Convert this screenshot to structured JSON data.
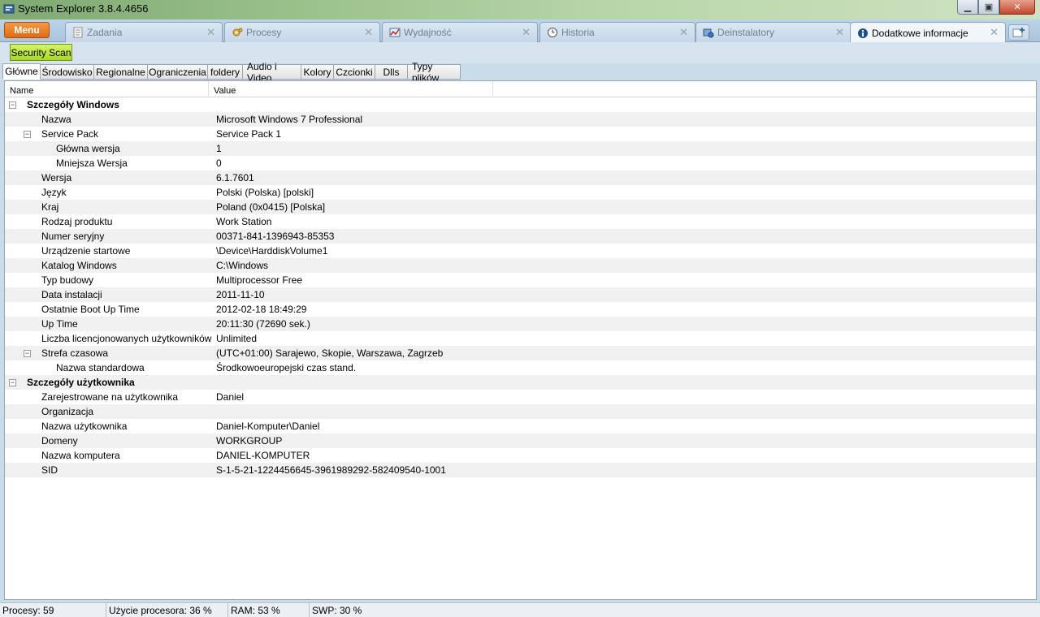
{
  "window": {
    "title": "System Explorer 3.8.4.4656",
    "min_label": "▁",
    "max_label": "▣",
    "close_label": "✕"
  },
  "menu": {
    "label": "Menu"
  },
  "tabs": [
    {
      "label": "Zadania",
      "icon": "tasks-icon"
    },
    {
      "label": "Procesy",
      "icon": "gears-icon"
    },
    {
      "label": "Wydajność",
      "icon": "performance-icon"
    },
    {
      "label": "Historia",
      "icon": "clock-icon"
    },
    {
      "label": "Deinstalatory",
      "icon": "uninstall-icon"
    },
    {
      "label": "Dodatkowe informacje",
      "icon": "info-icon"
    }
  ],
  "tab_close_label": "✕",
  "toolbar": {
    "security_scan": "Security Scan"
  },
  "subtabs": [
    "Główne",
    "Środowisko",
    "Regionalne",
    "Ograniczenia",
    "foldery",
    "Audio i Video",
    "Kolory",
    "Czcionki",
    "Dlls",
    "Typy plików"
  ],
  "grid": {
    "columns": {
      "name": "Name",
      "value": "Value"
    },
    "rows": [
      {
        "name": "Szczegóły Windows",
        "value": "",
        "level": 0,
        "group": true,
        "expander": "⊟"
      },
      {
        "name": "Nazwa",
        "value": "Microsoft Windows 7 Professional",
        "level": 1
      },
      {
        "name": "Service Pack",
        "value": "Service Pack 1",
        "level": 1,
        "expander": "⊟"
      },
      {
        "name": "Główna wersja",
        "value": "1",
        "level": 2
      },
      {
        "name": "Mniejsza Wersja",
        "value": "0",
        "level": 2
      },
      {
        "name": "Wersja",
        "value": "6.1.7601",
        "level": 1
      },
      {
        "name": "Język",
        "value": "Polski (Polska) [polski]",
        "level": 1
      },
      {
        "name": "Kraj",
        "value": "Poland (0x0415) [Polska]",
        "level": 1
      },
      {
        "name": "Rodzaj produktu",
        "value": "Work Station",
        "level": 1
      },
      {
        "name": "Numer seryjny",
        "value": "00371-841-1396943-85353",
        "level": 1
      },
      {
        "name": "Urządzenie startowe",
        "value": "\\Device\\HarddiskVolume1",
        "level": 1
      },
      {
        "name": "Katalog Windows",
        "value": "C:\\Windows",
        "level": 1
      },
      {
        "name": "Typ budowy",
        "value": "Multiprocessor Free",
        "level": 1
      },
      {
        "name": "Data instalacji",
        "value": "2011-11-10",
        "level": 1
      },
      {
        "name": "Ostatnie Boot Up Time",
        "value": "2012-02-18 18:49:29",
        "level": 1
      },
      {
        "name": "Up Time",
        "value": "20:11:30 (72690 sek.)",
        "level": 1
      },
      {
        "name": "Liczba licencjonowanych użytkowników",
        "value": "Unlimited",
        "level": 1
      },
      {
        "name": "Strefa czasowa",
        "value": "(UTC+01:00) Sarajewo, Skopie, Warszawa, Zagrzeb",
        "level": 1,
        "expander": "⊟"
      },
      {
        "name": "Nazwa standardowa",
        "value": "Środkowoeuropejski czas stand.",
        "level": 2
      },
      {
        "name": "Szczegóły użytkownika",
        "value": "",
        "level": 0,
        "group": true,
        "expander": "⊟"
      },
      {
        "name": "Zarejestrowane na użytkownika",
        "value": "Daniel",
        "level": 1
      },
      {
        "name": "Organizacja",
        "value": "",
        "level": 1
      },
      {
        "name": "Nazwa użytkownika",
        "value": "Daniel-Komputer\\Daniel",
        "level": 1
      },
      {
        "name": "Domeny",
        "value": "WORKGROUP",
        "level": 1
      },
      {
        "name": "Nazwa komputera",
        "value": "DANIEL-KOMPUTER",
        "level": 1
      },
      {
        "name": "SID",
        "value": "S-1-5-21-1224456645-3961989292-582409540-1001",
        "level": 1
      }
    ]
  },
  "status": {
    "processes": "Procesy: 59",
    "cpu": "Użycie procesora: 36 %",
    "ram": "RAM: 53 %",
    "swap": "SWP: 30 %"
  },
  "colors": {
    "menu_button": "#e06a10",
    "security_scan": "#a8d820",
    "title_bar": "#9cc28c"
  }
}
